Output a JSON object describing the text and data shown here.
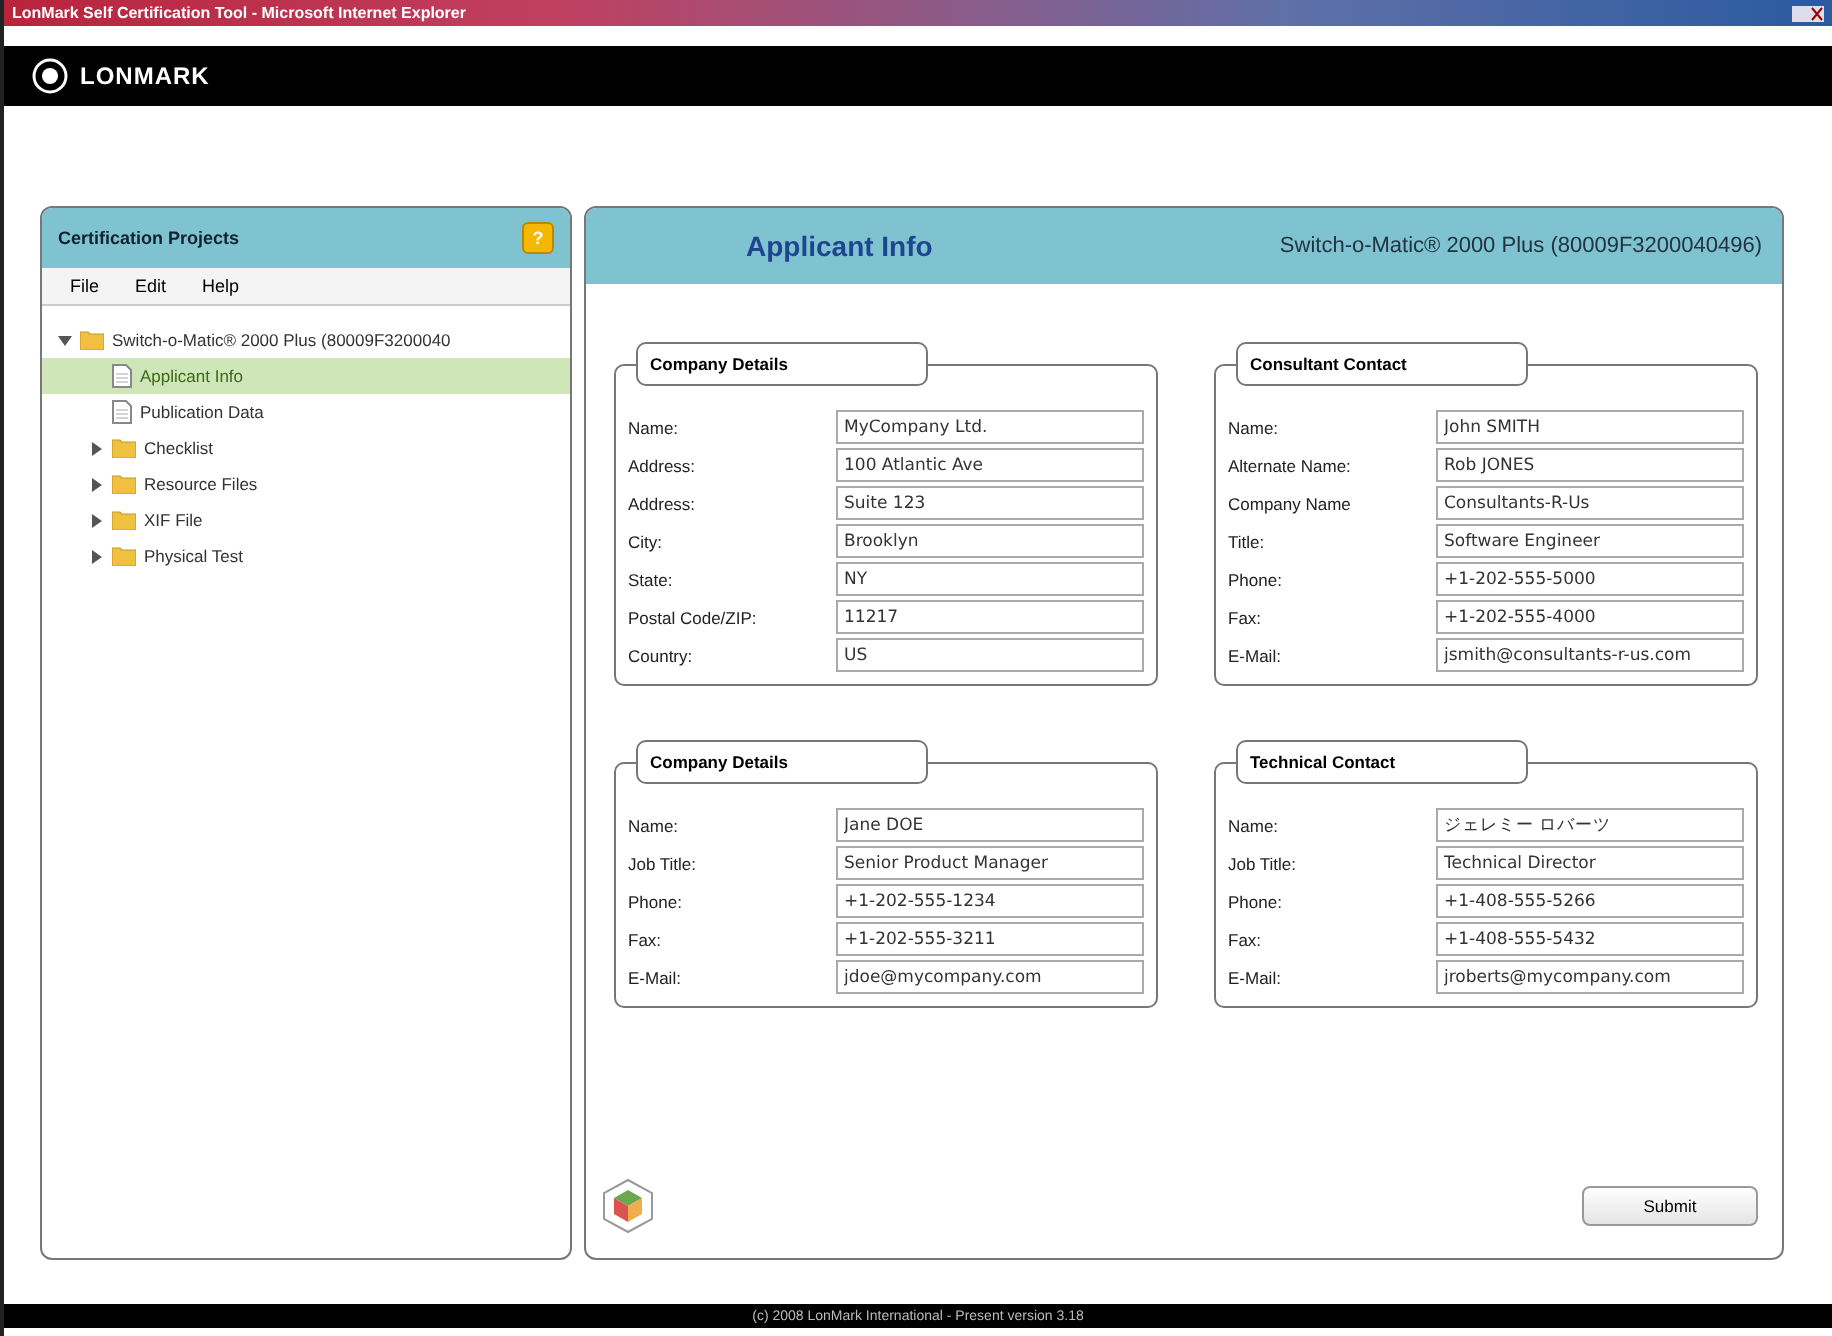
{
  "window": {
    "title": "LonMark Self Certification Tool - Microsoft Internet Explorer"
  },
  "header": {
    "logo": "LONMARK"
  },
  "sidebar": {
    "title": "Certification Projects",
    "help": "?",
    "menu": [
      "File",
      "Edit",
      "Help"
    ],
    "tree": [
      {
        "label": "Switch-o-Matic® 2000 Plus (80009F3200040",
        "kind": "folder",
        "expanded": true,
        "selected": false,
        "children": [
          {
            "label": "Applicant Info",
            "kind": "document",
            "selected": true
          },
          {
            "label": "Publication Data",
            "kind": "document",
            "selected": false
          },
          {
            "label": "Checklist",
            "kind": "folder",
            "expanded": false,
            "selected": false
          },
          {
            "label": "Resource Files",
            "kind": "folder",
            "expanded": false,
            "selected": false
          },
          {
            "label": "XIF File",
            "kind": "folder",
            "expanded": false,
            "selected": false
          },
          {
            "label": "Physical Test",
            "kind": "folder",
            "expanded": false,
            "selected": false
          }
        ]
      }
    ]
  },
  "main": {
    "title": "Applicant Info",
    "subtitle": "Switch-o-Matic® 2000 Plus (80009F3200040496)",
    "groups": [
      {
        "title": "Company Details",
        "fields": [
          {
            "label": "Name:",
            "value": "MyCompany Ltd."
          },
          {
            "label": "Address:",
            "value": "100 Atlantic Ave"
          },
          {
            "label": "Address:",
            "value": "Suite 123"
          },
          {
            "label": "City:",
            "value": "Brooklyn"
          },
          {
            "label": "State:",
            "value": "NY"
          },
          {
            "label": "Postal Code/ZIP:",
            "value": "11217"
          },
          {
            "label": "Country:",
            "value": "US"
          }
        ]
      },
      {
        "title": "Consultant Contact",
        "fields": [
          {
            "label": "Name:",
            "value": "John SMITH"
          },
          {
            "label": "Alternate Name:",
            "value": "Rob JONES"
          },
          {
            "label": "Company Name",
            "value": "Consultants-R-Us"
          },
          {
            "label": "Title:",
            "value": "Software Engineer"
          },
          {
            "label": "Phone:",
            "value": "+1-202-555-5000"
          },
          {
            "label": "Fax:",
            "value": "+1-202-555-4000"
          },
          {
            "label": "E-Mail:",
            "value": "jsmith@consultants-r-us.com"
          }
        ]
      },
      {
        "title": "Company Details",
        "fields": [
          {
            "label": "Name:",
            "value": "Jane DOE"
          },
          {
            "label": "Job Title:",
            "value": "Senior Product Manager"
          },
          {
            "label": "Phone:",
            "value": "+1-202-555-1234"
          },
          {
            "label": "Fax:",
            "value": "+1-202-555-3211"
          },
          {
            "label": "E-Mail:",
            "value": "jdoe@mycompany.com"
          }
        ]
      },
      {
        "title": "Technical Contact",
        "fields": [
          {
            "label": "Name:",
            "value": "ジェレミー ロバーツ"
          },
          {
            "label": "Job Title:",
            "value": "Technical Director"
          },
          {
            "label": "Phone:",
            "value": "+1-408-555-5266"
          },
          {
            "label": "Fax:",
            "value": "+1-408-555-5432"
          },
          {
            "label": "E-Mail:",
            "value": "jroberts@mycompany.com"
          }
        ]
      }
    ],
    "submit": "Submit"
  },
  "footer": "(c) 2008 LonMark International - Present version 3.18"
}
